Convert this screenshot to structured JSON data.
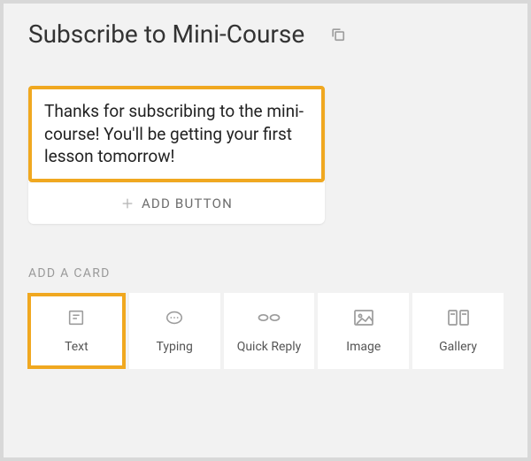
{
  "header": {
    "title": "Subscribe to Mini-Course",
    "copy_icon": "copy-icon"
  },
  "message": {
    "text": "Thanks for subscribing to the mini-course! You'll be getting your first lesson tomorrow!"
  },
  "add_button": {
    "label": "ADD BUTTON"
  },
  "section": {
    "label": "ADD A CARD"
  },
  "card_types": {
    "text": {
      "label": "Text",
      "selected": true
    },
    "typing": {
      "label": "Typing",
      "selected": false
    },
    "quick_reply": {
      "label": "Quick Reply",
      "selected": false
    },
    "image": {
      "label": "Image",
      "selected": false
    },
    "gallery": {
      "label": "Gallery",
      "selected": false
    }
  },
  "colors": {
    "highlight": "#f0a820",
    "canvas_bg": "#f2f2f2"
  }
}
